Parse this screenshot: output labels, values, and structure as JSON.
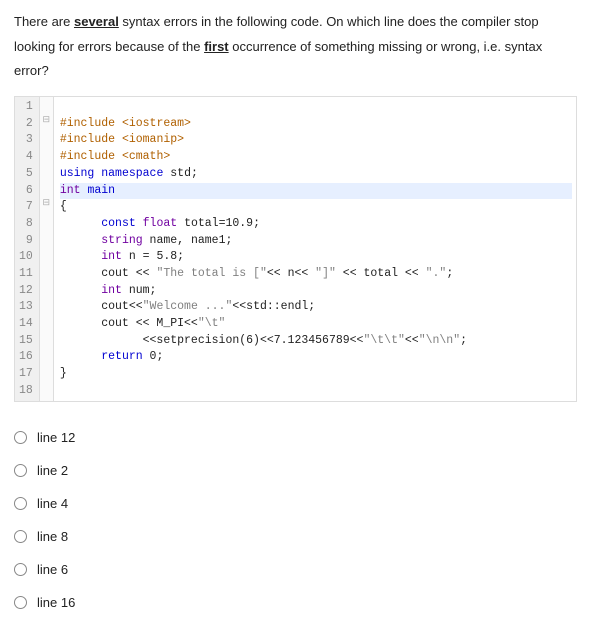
{
  "question": {
    "part1": "There are ",
    "emph1": "several",
    "part2": " syntax errors in the following code. On which line does the compiler stop looking for errors because of the ",
    "emph2": "first",
    "part3": " occurrence of something missing or wrong, i.e. syntax error?"
  },
  "code": {
    "lines": [
      {
        "n": "1",
        "fold": "",
        "text": ""
      },
      {
        "n": "2",
        "fold": "⊟",
        "html": "<span class='pp'>#include</span> <span class='inc'>&lt;iostream&gt;</span>"
      },
      {
        "n": "3",
        "fold": "",
        "html": "<span class='pp'>#include</span> <span class='inc'>&lt;iomanip&gt;</span>"
      },
      {
        "n": "4",
        "fold": "",
        "html": "<span class='pp'>#include</span> <span class='inc'>&lt;cmath&gt;</span>"
      },
      {
        "n": "5",
        "fold": "",
        "html": "<span class='kw'>using</span> <span class='kw'>namespace</span> std;"
      },
      {
        "n": "6",
        "fold": "",
        "hl": true,
        "html": "<span class='typ'>int</span> <span class='kw'>main</span>"
      },
      {
        "n": "7",
        "fold": "⊟",
        "html": "{"
      },
      {
        "n": "8",
        "fold": "",
        "html": "      <span class='kw'>const</span> <span class='typ'>float</span> total=10.9;"
      },
      {
        "n": "9",
        "fold": "",
        "html": "      <span class='typ'>string</span> name, name1;"
      },
      {
        "n": "10",
        "fold": "",
        "html": "      <span class='typ'>int</span> n = 5.8;"
      },
      {
        "n": "11",
        "fold": "",
        "html": "      cout &lt;&lt; <span class='str'>\"The total is [\"</span>&lt;&lt; n&lt;&lt; <span class='str'>\"]\"</span> &lt;&lt; total &lt;&lt; <span class='str'>\".\"</span>;"
      },
      {
        "n": "12",
        "fold": "",
        "html": "      <span class='typ'>int</span> num;"
      },
      {
        "n": "13",
        "fold": "",
        "html": "      cout&lt;&lt;<span class='str'>\"Welcome ...\"</span>&lt;&lt;std::endl;"
      },
      {
        "n": "14",
        "fold": "",
        "html": "      cout &lt;&lt; M_PI&lt;&lt;<span class='str'>\"\\t\"</span>"
      },
      {
        "n": "15",
        "fold": "",
        "html": "            &lt;&lt;setprecision(6)&lt;&lt;7.123456789&lt;&lt;<span class='str'>\"\\t\\t\"</span>&lt;&lt;<span class='str'>\"\\n\\n\"</span>;"
      },
      {
        "n": "16",
        "fold": "",
        "html": "      <span class='kw'>return</span> 0;"
      },
      {
        "n": "17",
        "fold": "",
        "html": "}"
      },
      {
        "n": "18",
        "fold": "",
        "html": ""
      }
    ]
  },
  "options": [
    {
      "label": "line 12"
    },
    {
      "label": "line 2"
    },
    {
      "label": "line 4"
    },
    {
      "label": "line 8"
    },
    {
      "label": "line 6"
    },
    {
      "label": "line 16"
    }
  ]
}
